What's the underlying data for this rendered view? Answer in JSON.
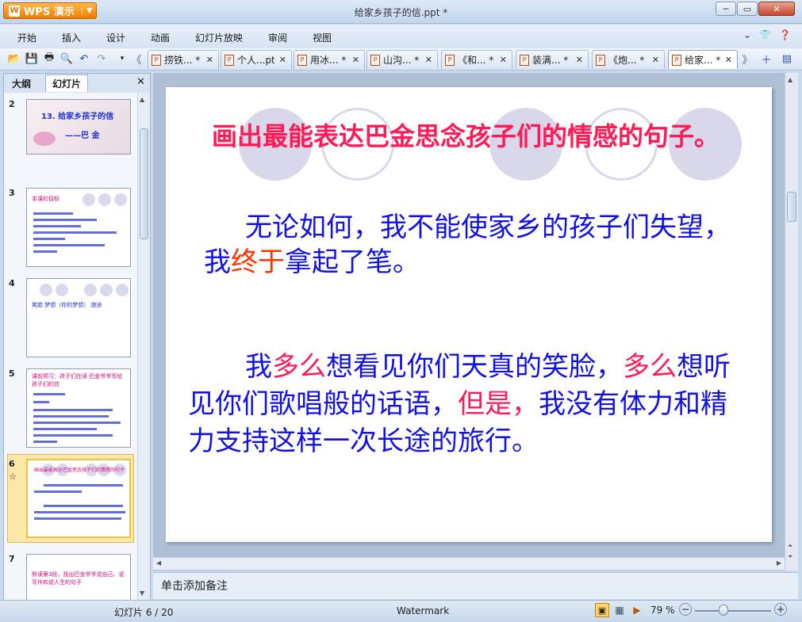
{
  "app": {
    "brand": "WPS 演示",
    "title": "给家乡孩子的信.ppt *"
  },
  "menu": [
    "开始",
    "插入",
    "设计",
    "动画",
    "幻灯片放映",
    "审阅",
    "视图"
  ],
  "tabs": [
    {
      "label": "捞铁... *",
      "active": false
    },
    {
      "label": "个人...pt",
      "active": false
    },
    {
      "label": "用冰... *",
      "active": false
    },
    {
      "label": "山沟... *",
      "active": false
    },
    {
      "label": "《和... *",
      "active": false
    },
    {
      "label": "装满... *",
      "active": false
    },
    {
      "label": "《炮... *",
      "active": false
    },
    {
      "label": "给家... *",
      "active": true
    }
  ],
  "panel": {
    "tab_outline": "大纲",
    "tab_slides": "幻灯片"
  },
  "thumbnails": [
    {
      "num": "2",
      "title": "13. 给家乡孩子的信",
      "subtitle": "——巴 金"
    },
    {
      "num": "3",
      "heading": "本课的目标"
    },
    {
      "num": "4",
      "text": "笑脸  梦想（你的梦想）  旅途"
    },
    {
      "num": "5",
      "heading": "课前预习：孩子们在读 巴金爷爷写给孩子们的信"
    },
    {
      "num": "6",
      "star": "☆",
      "selected": true,
      "heading": "画出最能表达巴金思念孩子们的情感的句子"
    },
    {
      "num": "7",
      "text": "默读第3段，找出巴金爷爷说自己、说写作和说人生的句子"
    }
  ],
  "slide": {
    "heading": "画出最能表达巴金思念孩子们的情感的句子。",
    "p1": {
      "a": "无论如何，我不能使家乡的孩子们失望，我",
      "b": "终于",
      "c": "拿起了笔。"
    },
    "p2": {
      "a": "我",
      "b": "多么",
      "c": "想看见你们天真的笑脸，",
      "d": "多么",
      "e": "想听见你们歌唱般的话语，",
      "f": "但是，",
      "g": "我没有体力和精力支持这样一次长途的旅行。"
    }
  },
  "notes_placeholder": "单击添加备注",
  "status": {
    "slide_indicator": "幻灯片 6 / 20",
    "theme": "Watermark",
    "zoom": "79 %"
  },
  "colors": {
    "slide_text": "#1111e6",
    "slide_highlight": "#ff1a55",
    "slide_emphasis": "#ff3300",
    "accent": "#f07d00"
  }
}
